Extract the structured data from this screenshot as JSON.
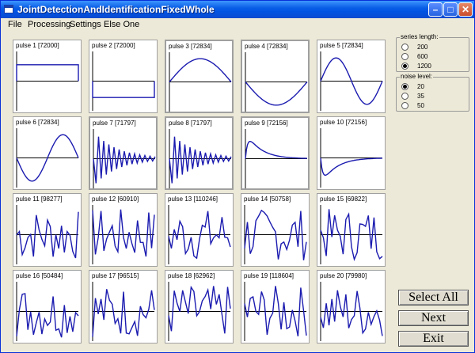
{
  "window": {
    "title": "JointDetectionAndIdentificationFixedWhole"
  },
  "titlebar_buttons": {
    "minimize": "–",
    "maximize": "□",
    "close": "✕"
  },
  "menu": [
    "File",
    "Processing",
    "Settings",
    "Else One"
  ],
  "pulses": [
    {
      "label": "pulse 1 [72000]",
      "kind": "rect_up"
    },
    {
      "label": "pulse 2 [72000]",
      "kind": "rect_down"
    },
    {
      "label": "pulse 3 [72834]",
      "kind": "sine_half_up",
      "selected": true
    },
    {
      "label": "pulse 4 [72834]",
      "kind": "sine_half_down",
      "selected": true
    },
    {
      "label": "pulse 5 [72834]",
      "kind": "sine_full"
    },
    {
      "label": "pulse 6 [72834]",
      "kind": "sine_full_inv"
    },
    {
      "label": "pulse 7 [71797]",
      "kind": "damped",
      "selected": true
    },
    {
      "label": "pulse 8 [71797]",
      "kind": "damped",
      "selected": true
    },
    {
      "label": "pulse 9 [72156]",
      "kind": "decay_up",
      "selected": true
    },
    {
      "label": "pulse 10 [72156]",
      "kind": "decay_down"
    },
    {
      "label": "pulse 11 [98277]",
      "kind": "noise"
    },
    {
      "label": "pulse 12 [60910]",
      "kind": "noise"
    },
    {
      "label": "pulse 13 [110246]",
      "kind": "noise"
    },
    {
      "label": "pulse 14 [50758]",
      "kind": "noise"
    },
    {
      "label": "pulse 15 [69822]",
      "kind": "noise"
    },
    {
      "label": "pulse 16 [50484]",
      "kind": "noise"
    },
    {
      "label": "pulse 17 [96515]",
      "kind": "noise"
    },
    {
      "label": "pulse 18 [62962]",
      "kind": "noise"
    },
    {
      "label": "pulse 19 [118604]",
      "kind": "noise"
    },
    {
      "label": "pulse 20 [79980]",
      "kind": "noise"
    }
  ],
  "series_length": {
    "label": "series length:",
    "options": [
      "200",
      "600",
      "1200"
    ],
    "selected": "1200"
  },
  "noise_level": {
    "label": "noise level:",
    "options": [
      "20",
      "35",
      "50"
    ],
    "selected": "20"
  },
  "buttons": {
    "select_all": "Select All",
    "next": "Next",
    "exit": "Exit"
  },
  "colors": {
    "signal": "#1b1bb0",
    "axis": "#000000",
    "titlebar": "#0054e3"
  }
}
